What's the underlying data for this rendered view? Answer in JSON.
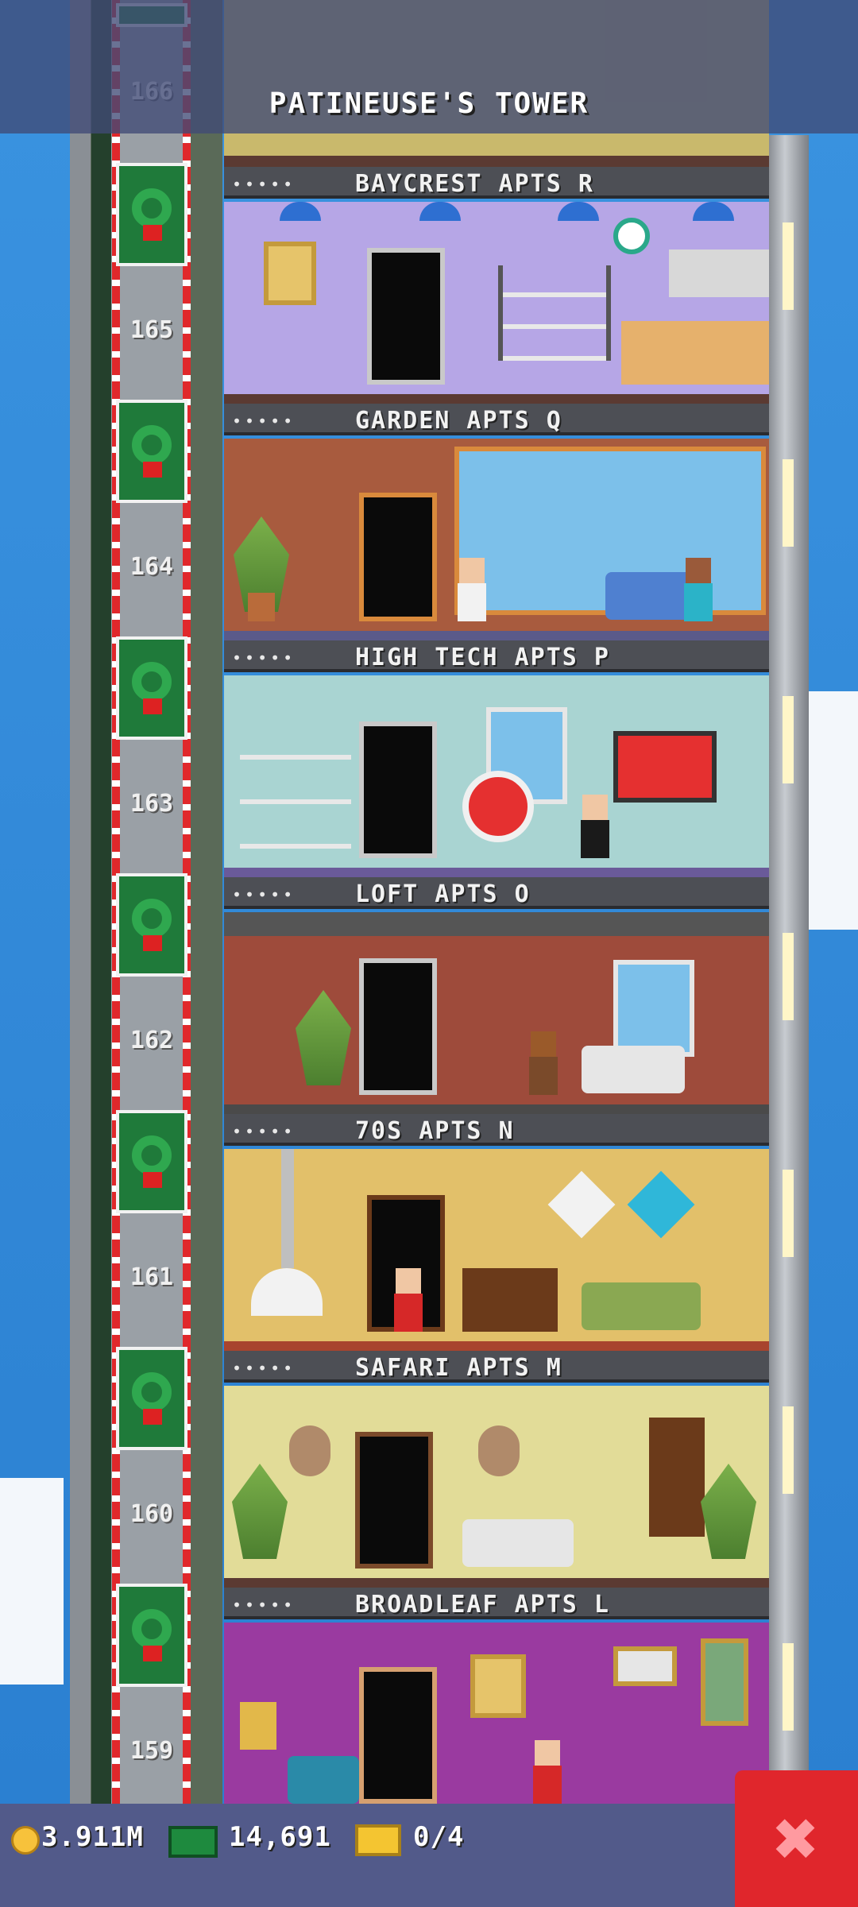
{
  "header": {
    "title": "PATINEUSE'S TOWER"
  },
  "elevator": {
    "floor_numbers": [
      "166",
      "165",
      "164",
      "163",
      "162",
      "161",
      "160",
      "159"
    ]
  },
  "floors": [
    {
      "stars": "•••••",
      "name": "BAYCREST APTS R",
      "wall_color": "#b6a6e6"
    },
    {
      "stars": "•••••",
      "name": "GARDEN APTS Q",
      "wall_color": "#a85b3e"
    },
    {
      "stars": "•••••",
      "name": "HIGH TECH APTS P",
      "wall_color": "#a9d4d2"
    },
    {
      "stars": "•••••",
      "name": "LOFT APTS O",
      "wall_color": "#9e4b3b"
    },
    {
      "stars": "•••••",
      "name": "70S APTS N",
      "wall_color": "#e2c06a"
    },
    {
      "stars": "•••••",
      "name": "SAFARI APTS M",
      "wall_color": "#e2dc98"
    },
    {
      "stars": "•••••",
      "name": "BROADLEAF APTS L",
      "wall_color": "#9a3aa0"
    }
  ],
  "footer": {
    "coins": "3.911M",
    "bux": "14,691",
    "tickets": "0/4",
    "close_symbol": "✖"
  },
  "icons": [
    "coin-icon",
    "bux-icon",
    "ticket-icon",
    "close-icon",
    "wreath-icon"
  ]
}
